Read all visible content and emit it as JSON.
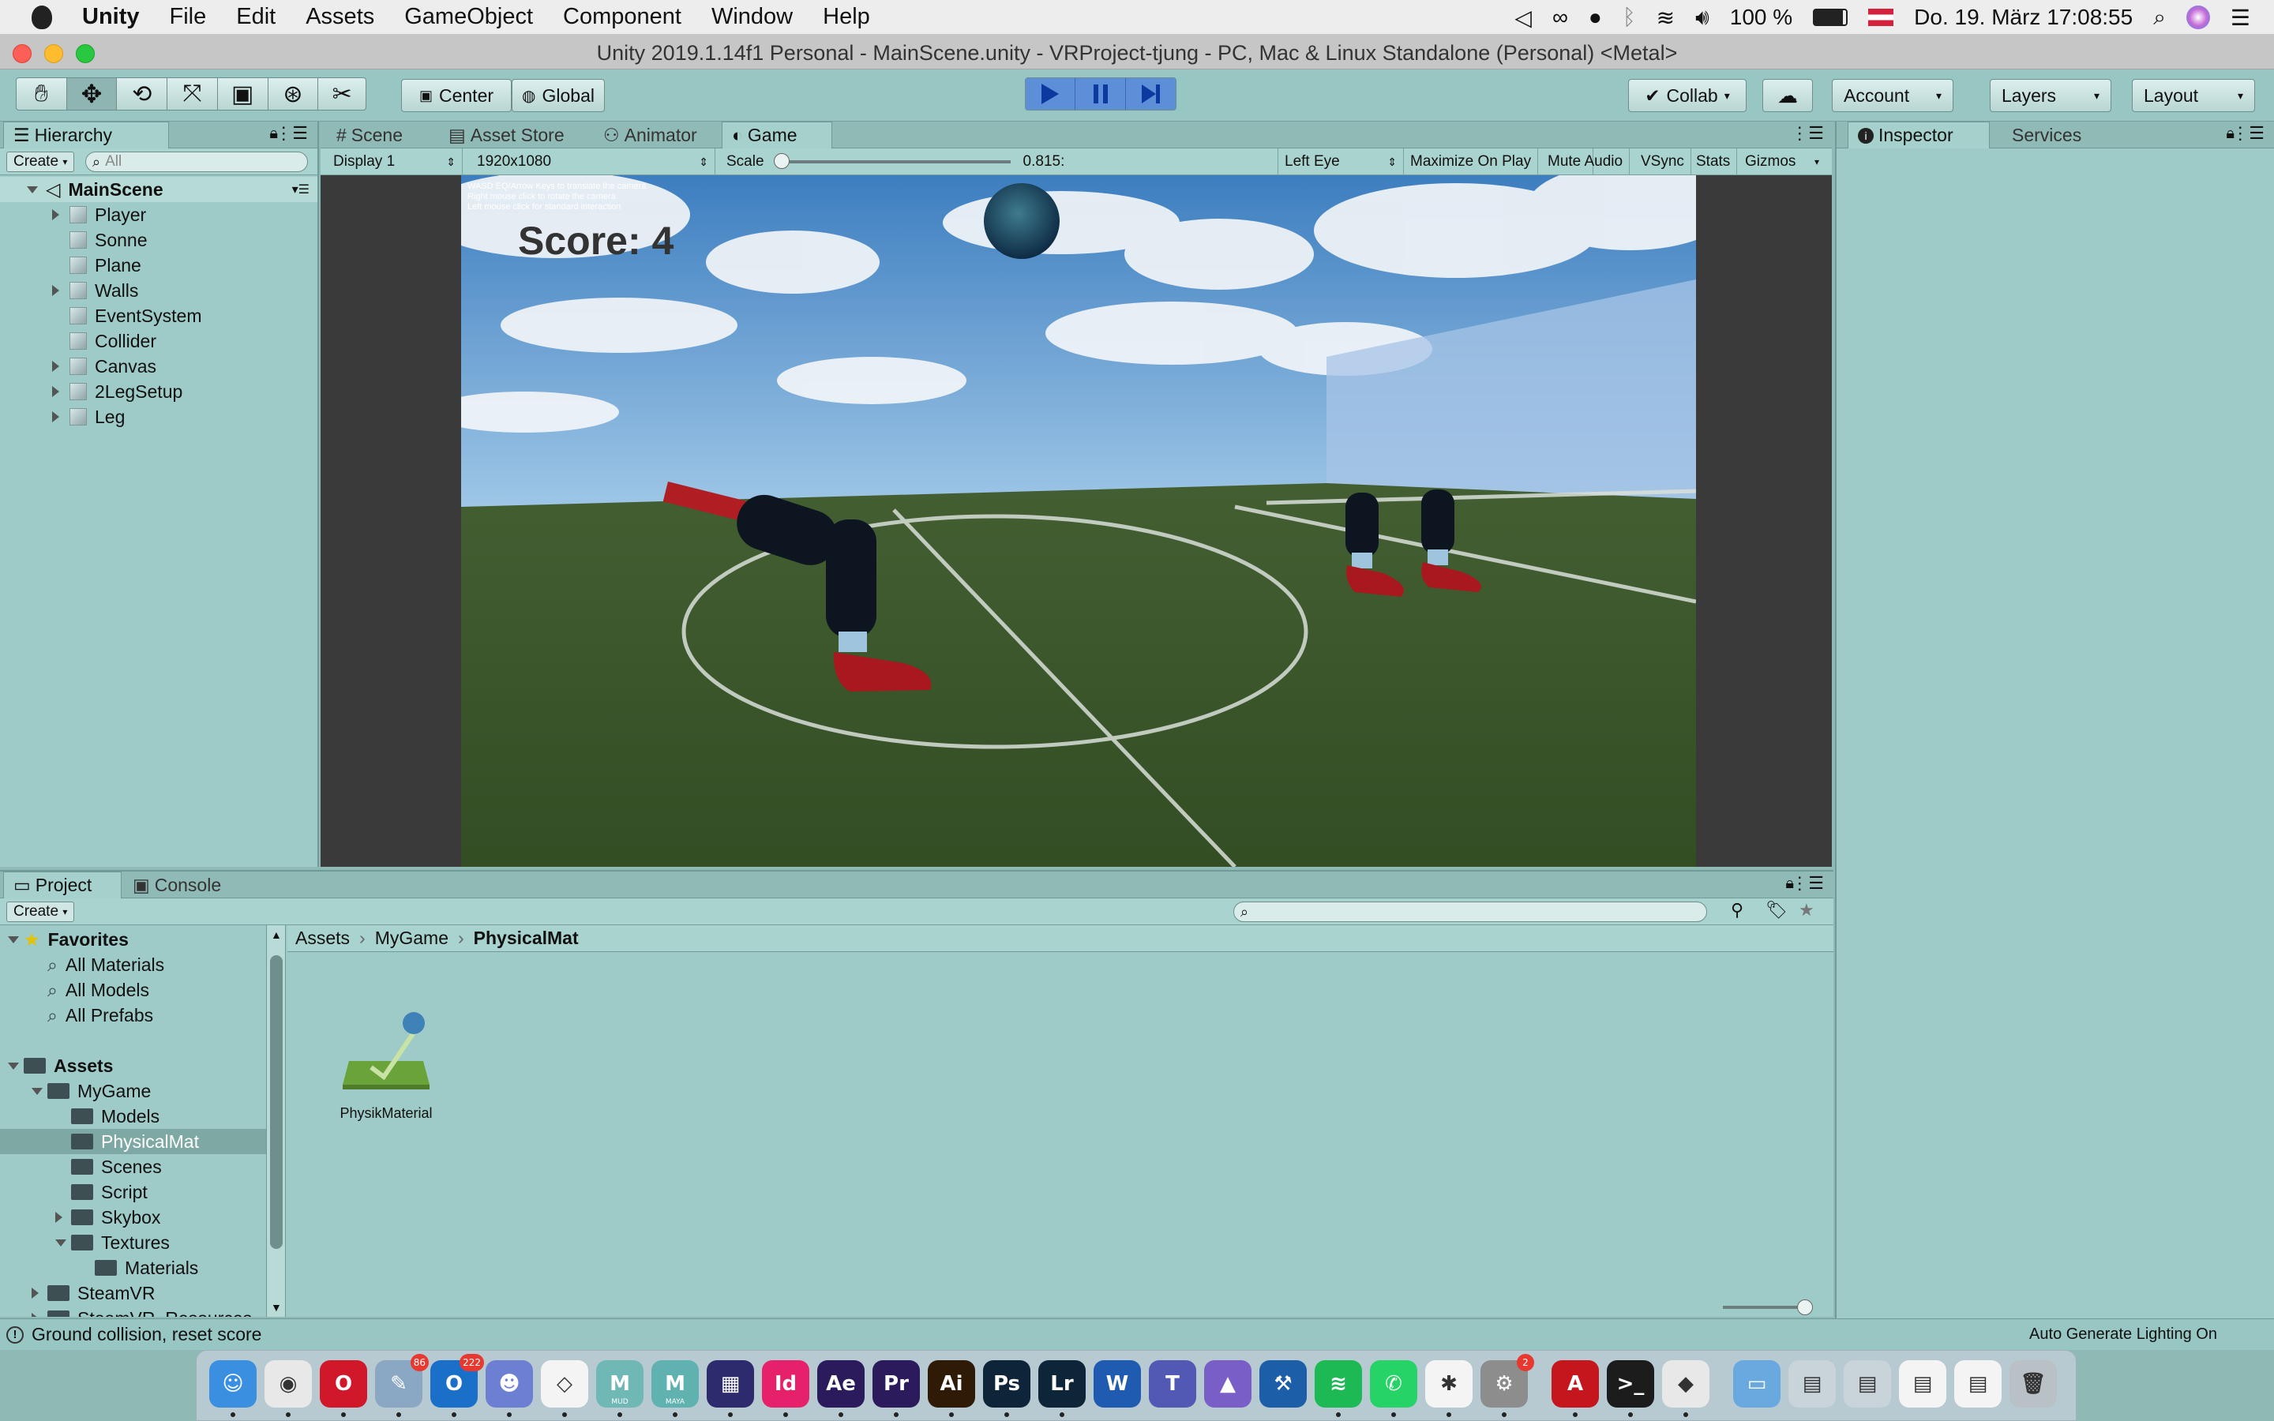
{
  "menubar": {
    "apple": "",
    "items": [
      "Unity",
      "File",
      "Edit",
      "Assets",
      "GameObject",
      "Component",
      "Window",
      "Help"
    ],
    "battery": "100 %",
    "clock": "Do. 19. März  17:08:55"
  },
  "window": {
    "title": "Unity 2019.1.14f1 Personal - MainScene.unity - VRProject-tjung - PC, Mac & Linux Standalone (Personal) <Metal>"
  },
  "toolbar": {
    "center": "Center",
    "global": "Global",
    "collab": "Collab",
    "account": "Account",
    "layers": "Layers",
    "layout": "Layout"
  },
  "hierarchy": {
    "tab": "Hierarchy",
    "create": "Create",
    "search_placeholder": "All",
    "scene": "MainScene",
    "items": [
      {
        "label": "Player",
        "expandable": true
      },
      {
        "label": "Sonne",
        "expandable": false
      },
      {
        "label": "Plane",
        "expandable": false
      },
      {
        "label": "Walls",
        "expandable": true
      },
      {
        "label": "EventSystem",
        "expandable": false
      },
      {
        "label": "Collider",
        "expandable": false
      },
      {
        "label": "Canvas",
        "expandable": true
      },
      {
        "label": "2LegSetup",
        "expandable": true
      },
      {
        "label": "Leg",
        "expandable": true
      }
    ]
  },
  "center_tabs": {
    "scene": "Scene",
    "asset_store": "Asset Store",
    "animator": "Animator",
    "game": "Game"
  },
  "game_toolbar": {
    "display": "Display 1",
    "resolution": "1920x1080",
    "scale_label": "Scale",
    "scale_value": "0.815:",
    "eye": "Left Eye",
    "maximize": "Maximize On Play",
    "mute": "Mute Audio",
    "vsync": "VSync",
    "stats": "Stats",
    "gizmos": "Gizmos"
  },
  "game_view": {
    "help_lines": [
      "WASD EQ/Arrow Keys to translate the camera",
      "Right mouse click to rotate the camera",
      "Left mouse click for standard interaction"
    ],
    "score": "Score: 4"
  },
  "inspector": {
    "tab": "Inspector",
    "services": "Services"
  },
  "project": {
    "tab": "Project",
    "console": "Console",
    "create": "Create",
    "breadcrumb": [
      "Assets",
      "MyGame",
      "PhysicalMat"
    ],
    "tree": [
      {
        "label": "Favorites",
        "level": 0,
        "kind": "favorites",
        "open": true
      },
      {
        "label": "All Materials",
        "level": 1,
        "kind": "search"
      },
      {
        "label": "All Models",
        "level": 1,
        "kind": "search"
      },
      {
        "label": "All Prefabs",
        "level": 1,
        "kind": "search"
      },
      {
        "label": "Assets",
        "level": 0,
        "kind": "folder",
        "open": true
      },
      {
        "label": "MyGame",
        "level": 1,
        "kind": "folder",
        "open": true
      },
      {
        "label": "Models",
        "level": 2,
        "kind": "folder"
      },
      {
        "label": "PhysicalMat",
        "level": 2,
        "kind": "folder",
        "selected": true
      },
      {
        "label": "Scenes",
        "level": 2,
        "kind": "folder"
      },
      {
        "label": "Script",
        "level": 2,
        "kind": "folder"
      },
      {
        "label": "Skybox",
        "level": 2,
        "kind": "folder",
        "closed": true
      },
      {
        "label": "Textures",
        "level": 2,
        "kind": "folder",
        "open": true
      },
      {
        "label": "Materials",
        "level": 3,
        "kind": "folder"
      },
      {
        "label": "SteamVR",
        "level": 1,
        "kind": "folder",
        "closed": true
      },
      {
        "label": "SteamVR_Resources",
        "level": 1,
        "kind": "folder",
        "closed": true
      }
    ],
    "asset": "PhysikMaterial"
  },
  "status": {
    "message": "Ground collision, reset score",
    "right": "Auto Generate Lighting On"
  },
  "dock": {
    "apps": [
      {
        "name": "finder",
        "label": "",
        "color": "#3a8fe0",
        "text": "☺"
      },
      {
        "name": "chrome",
        "label": "",
        "color": "#e8e8e8",
        "text": "◉"
      },
      {
        "name": "opera",
        "label": "",
        "color": "#d0182a",
        "text": "O"
      },
      {
        "name": "preview",
        "label": "",
        "color": "#8aa7c4",
        "text": "✎",
        "badge": "86"
      },
      {
        "name": "outlook",
        "label": "",
        "color": "#1a6fc9",
        "text": "O",
        "badge": "222"
      },
      {
        "name": "discord",
        "label": "",
        "color": "#6d7fd3",
        "text": "☻"
      },
      {
        "name": "unity-hub",
        "label": "",
        "color": "#f4f4f4",
        "text": "◇"
      },
      {
        "name": "mudbox",
        "label": "MUD",
        "color": "#6fb8b6",
        "text": "M"
      },
      {
        "name": "maya",
        "label": "MAYA",
        "color": "#5fb2b0",
        "text": "M"
      },
      {
        "name": "visual-studio-mac",
        "label": "",
        "color": "#2d2a6e",
        "text": "▦"
      },
      {
        "name": "indesign",
        "label": "",
        "color": "#e6206b",
        "text": "Id"
      },
      {
        "name": "after-effects",
        "label": "",
        "color": "#2b1a5c",
        "text": "Ae"
      },
      {
        "name": "premiere",
        "label": "",
        "color": "#2b1a5c",
        "text": "Pr"
      },
      {
        "name": "illustrator",
        "label": "",
        "color": "#2e1a05",
        "text": "Ai"
      },
      {
        "name": "photoshop",
        "label": "",
        "color": "#0e2438",
        "text": "Ps"
      },
      {
        "name": "lightroom",
        "label": "",
        "color": "#0e2438",
        "text": "Lr"
      },
      {
        "name": "word",
        "label": "",
        "color": "#1f5bb0",
        "text": "W"
      },
      {
        "name": "teams",
        "label": "",
        "color": "#5159b4",
        "text": "T"
      },
      {
        "name": "affinity",
        "label": "",
        "color": "#7a5ec8",
        "text": "▲"
      },
      {
        "name": "xcode",
        "label": "",
        "color": "#1d5ea8",
        "text": "⚒"
      },
      {
        "name": "spotify",
        "label": "",
        "color": "#1db954",
        "text": "≋"
      },
      {
        "name": "whatsapp",
        "label": "",
        "color": "#25d366",
        "text": "✆"
      },
      {
        "name": "slack",
        "label": "",
        "color": "#f4f4f4",
        "text": "✱"
      },
      {
        "name": "system-preferences",
        "label": "",
        "color": "#8d8d8d",
        "text": "⚙",
        "badge": "2"
      },
      {
        "name": "acrobat",
        "label": "",
        "color": "#c5161d",
        "text": "A"
      },
      {
        "name": "terminal",
        "label": "",
        "color": "#1c1c1c",
        "text": ">_"
      },
      {
        "name": "unity",
        "label": "",
        "color": "#e8e8e8",
        "text": "◆"
      },
      {
        "name": "folder",
        "label": "",
        "color": "#6aa9e0",
        "text": "▭"
      },
      {
        "name": "screenshot-1",
        "label": "",
        "color": "#c9d3da",
        "text": "▤"
      },
      {
        "name": "screenshot-2",
        "label": "",
        "color": "#c9d3da",
        "text": "▤"
      },
      {
        "name": "document-1",
        "label": "",
        "color": "#f4f4f4",
        "text": "▤"
      },
      {
        "name": "document-2",
        "label": "",
        "color": "#f4f4f4",
        "text": "▤"
      },
      {
        "name": "trash",
        "label": "",
        "color": "#b9c1c6",
        "text": "🗑"
      }
    ]
  }
}
